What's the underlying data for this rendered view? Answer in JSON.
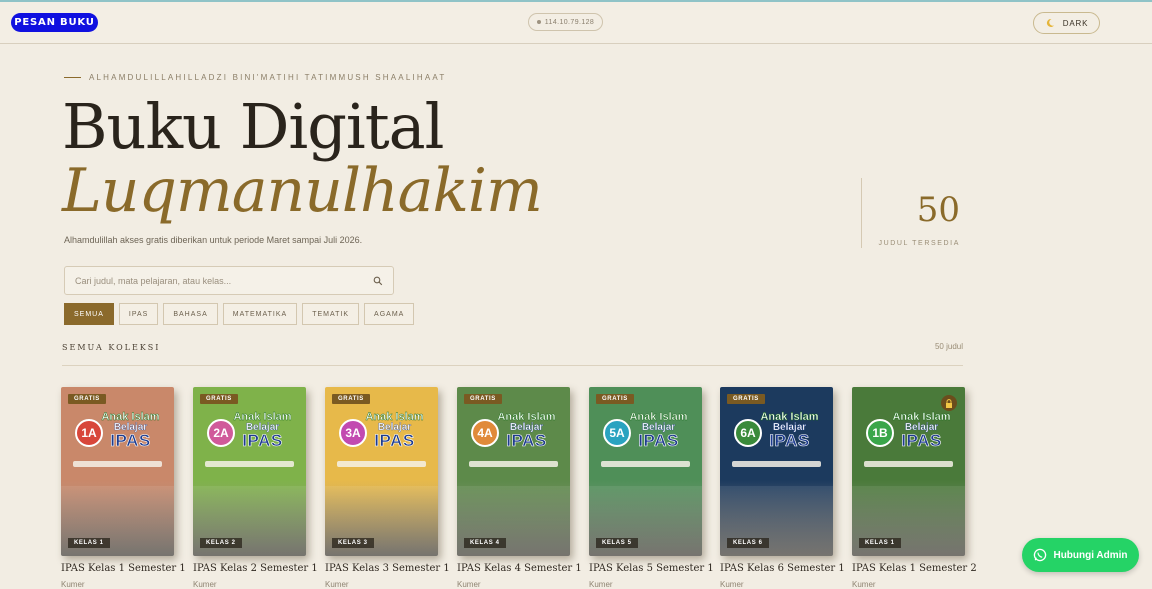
{
  "topbar": {
    "order_button": "PESAN BUKU",
    "ip_address": "114.10.79.128",
    "theme_toggle": "DARK"
  },
  "hero": {
    "eyebrow": "ALHAMDULILLAHILLADZI BINI'MATIHI TATIMMUSH SHAALIHAAT",
    "title_line1": "Buku Digital",
    "title_line2": "Luqmanulhakim",
    "subtitle": "Alhamdulillah akses gratis diberikan untuk periode Maret sampai Juli 2026.",
    "stat_value": "50",
    "stat_label": "JUDUL TERSEDIA"
  },
  "search": {
    "placeholder": "Cari judul, mata pelajaran, atau kelas..."
  },
  "filters": [
    "SEMUA",
    "IPAS",
    "BAHASA",
    "MATEMATIKA",
    "TEMATIK",
    "AGAMA"
  ],
  "collection": {
    "title": "SEMUA KOLEKSI",
    "count": "50 judul"
  },
  "books": [
    {
      "title": "IPAS Kelas 1 Semester 1",
      "subtitle": "Kumer",
      "badge": "GRATIS",
      "kelas": "KELAS 1",
      "grade": "1A",
      "locked": false,
      "color": "#c9886a"
    },
    {
      "title": "IPAS Kelas 2 Semester 1",
      "subtitle": "Kumer",
      "badge": "GRATIS",
      "kelas": "KELAS 2",
      "grade": "2A",
      "locked": false,
      "color": "#7fb24a"
    },
    {
      "title": "IPAS Kelas 3 Semester 1",
      "subtitle": "Kumer",
      "badge": "GRATIS",
      "kelas": "KELAS 3",
      "grade": "3A",
      "locked": false,
      "color": "#e7b94a"
    },
    {
      "title": "IPAS Kelas 4 Semester 1",
      "subtitle": "Kumer",
      "badge": "GRATIS",
      "kelas": "KELAS 4",
      "grade": "4A",
      "locked": false,
      "color": "#5d8a4a"
    },
    {
      "title": "IPAS Kelas 5 Semester 1",
      "subtitle": "Kumer",
      "badge": "GRATIS",
      "kelas": "KELAS 5",
      "grade": "5A",
      "locked": false,
      "color": "#4f8f58"
    },
    {
      "title": "IPAS Kelas 6 Semester 1",
      "subtitle": "Kumer",
      "badge": "GRATIS",
      "kelas": "KELAS 6",
      "grade": "6A",
      "locked": false,
      "color": "#1c3a5e"
    },
    {
      "title": "IPAS Kelas 1 Semester 2",
      "subtitle": "Kumer",
      "badge": "",
      "kelas": "KELAS 1",
      "grade": "1B",
      "locked": true,
      "color": "#4a7a3a"
    }
  ],
  "cover_text": {
    "line1": "Anak Islam",
    "line2": "Belajar",
    "line3": "IPAS"
  },
  "whatsapp": {
    "label": "Hubungi Admin"
  },
  "colors": {
    "background": "#f2ede3",
    "accent_gold": "#8a6a2a",
    "order_button": "#1010e0",
    "whatsapp": "#25d366"
  }
}
